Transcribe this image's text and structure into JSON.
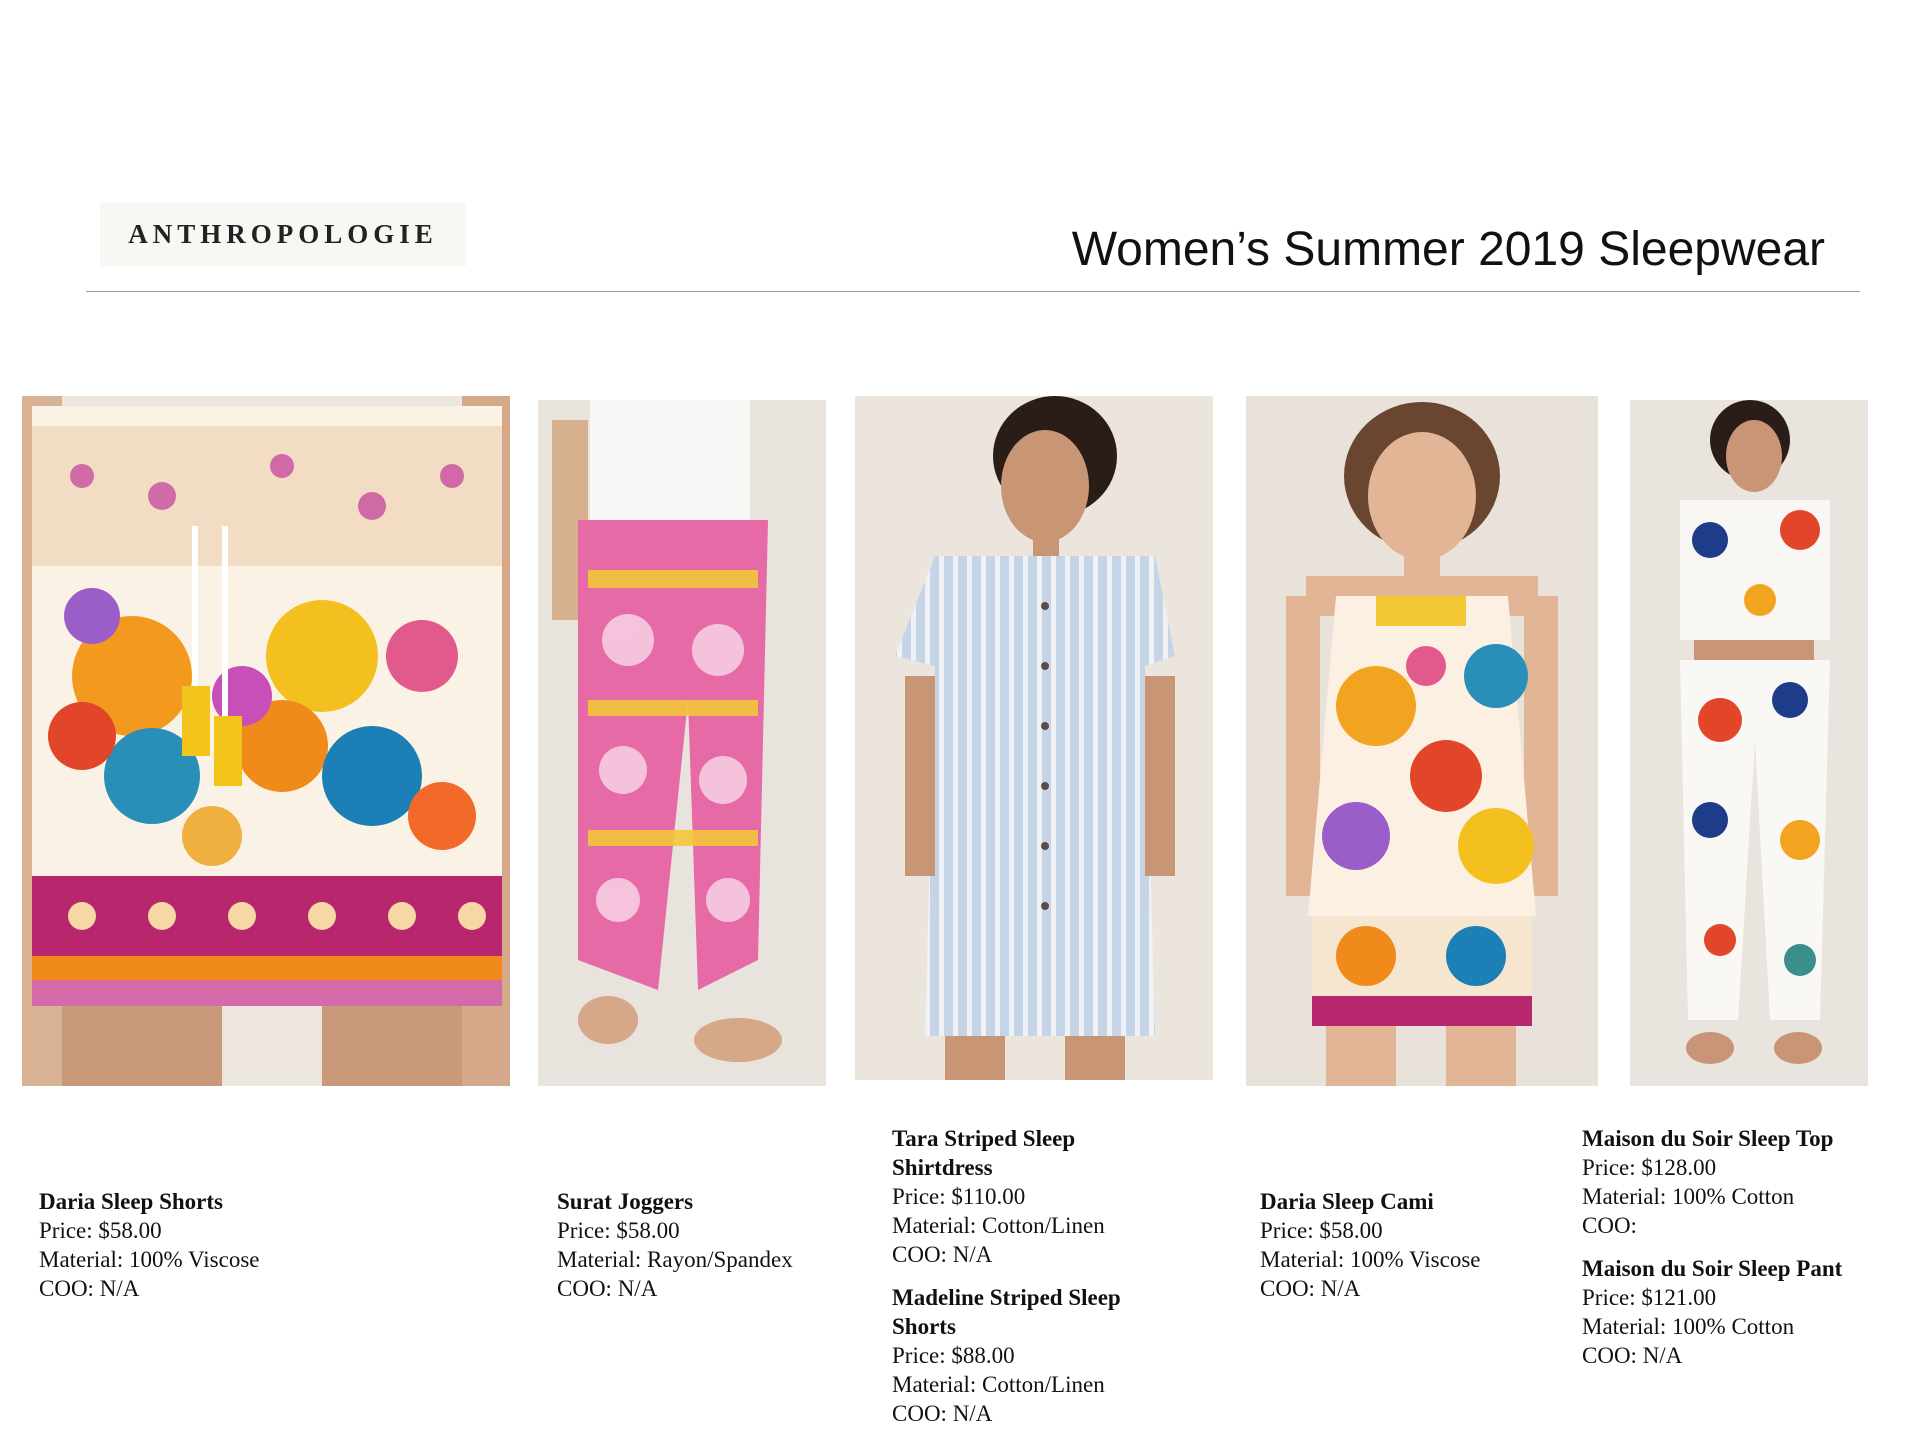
{
  "header": {
    "logo": "ANTHROPOLOGIE",
    "title": "Women’s Summer 2019 Sleepwear"
  },
  "products": [
    {
      "name": "Daria Sleep Shorts",
      "price": "Price: $58.00",
      "material": "Material: 100% Viscose",
      "coo": "COO: N/A"
    },
    {
      "name": "Surat Joggers",
      "price": "Price: $58.00",
      "material": "Material: Rayon/Spandex",
      "coo": "COO: N/A"
    },
    {
      "name": "Tara Striped Sleep Shirtdress",
      "price": "Price: $110.00",
      "material": "Material: Cotton/Linen",
      "coo": "COO: N/A"
    },
    {
      "name": "Madeline Striped Sleep Shorts",
      "price": "Price: $88.00",
      "material": "Material: Cotton/Linen",
      "coo": "COO: N/A"
    },
    {
      "name": "Daria Sleep Cami",
      "price": "Price: $58.00",
      "material": "Material: 100% Viscose",
      "coo": "COO: N/A"
    },
    {
      "name": "Maison du Soir Sleep Top",
      "price": "Price: $128.00",
      "material": "Material: 100% Cotton",
      "coo": "COO:"
    },
    {
      "name": "Maison du Soir Sleep Pant",
      "price": "Price: $121.00",
      "material": "Material: 100% Cotton",
      "coo": "COO: N/A"
    }
  ]
}
